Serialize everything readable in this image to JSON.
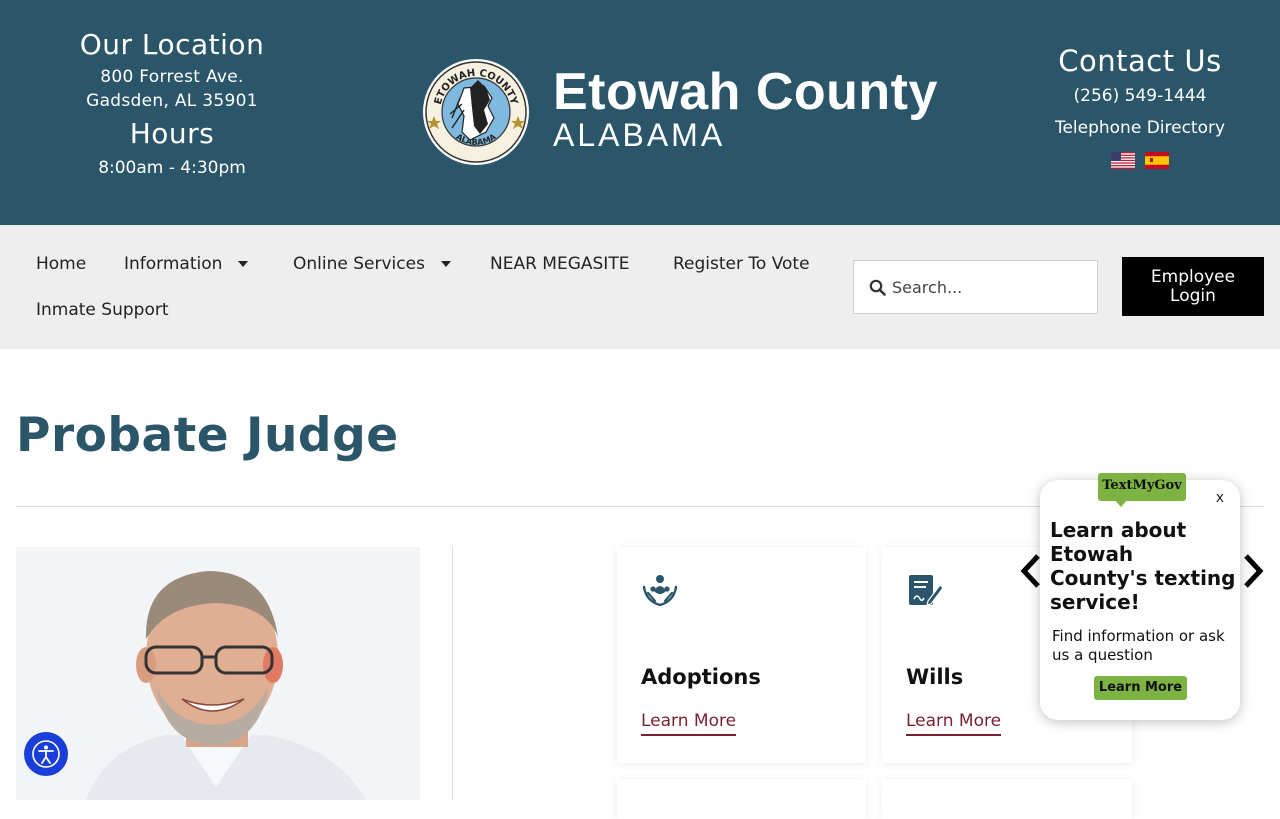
{
  "header": {
    "location_title": "Our Location",
    "address_line1": "800 Forrest Ave.",
    "address_line2": "Gadsden, AL 35901",
    "hours_title": "Hours",
    "hours": "8:00am - 4:30pm",
    "brand_name": "Etowah County",
    "brand_state": "ALABAMA",
    "seal_text_top": "ETOWAH COUNTY",
    "seal_text_bottom": "ALABAMA",
    "contact_title": "Contact Us",
    "phone": "(256) 549-1444",
    "directory_link": "Telephone Directory",
    "flags": [
      "us-flag-icon",
      "spain-flag-icon"
    ]
  },
  "nav": {
    "items": [
      {
        "label": "Home",
        "has_dropdown": false
      },
      {
        "label": "Information",
        "has_dropdown": true
      },
      {
        "label": "Online Services",
        "has_dropdown": true
      },
      {
        "label": "NEAR MEGASITE",
        "has_dropdown": false
      },
      {
        "label": "Register To Vote",
        "has_dropdown": false
      },
      {
        "label": "Inmate Support",
        "has_dropdown": false
      }
    ],
    "search_placeholder": "Search...",
    "login_label_line1": "Employee",
    "login_label_line2": "Login"
  },
  "main": {
    "title": "Probate Judge",
    "cards": [
      {
        "title": "Adoptions",
        "link": "Learn More",
        "icon": "adoption-hands-icon"
      },
      {
        "title": "Wills",
        "link": "Learn More",
        "icon": "will-document-icon"
      }
    ]
  },
  "textmygov": {
    "logo": "TextMyGov",
    "close": "x",
    "title": "Learn about Etowah County's texting service!",
    "text": "Find information or ask us a question",
    "button": "Learn More"
  },
  "colors": {
    "header_bg": "#2b5568",
    "nav_bg": "#eeeeee",
    "title_color": "#2b5568",
    "link_color": "#7a1f33",
    "tmg_green": "#7cb342",
    "a11y_blue": "#1a3fd8"
  }
}
